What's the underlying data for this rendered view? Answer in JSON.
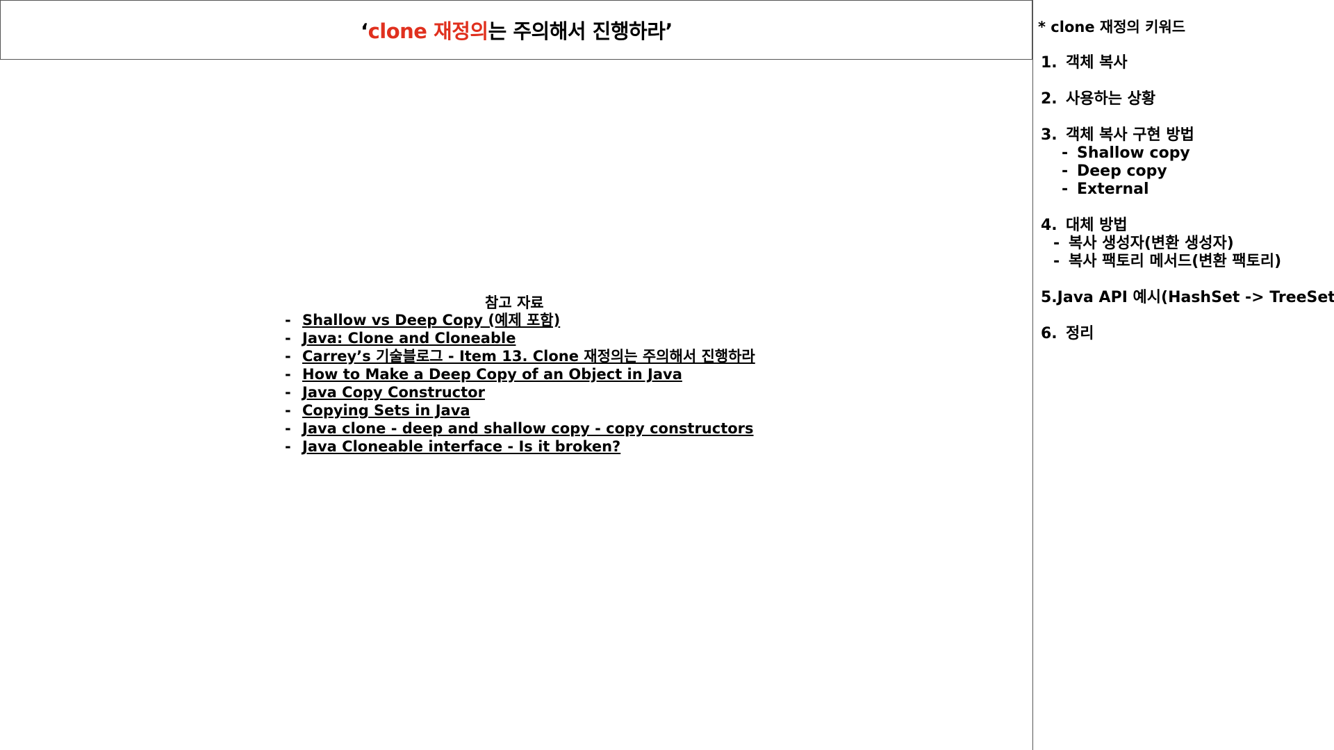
{
  "title": {
    "open_quote": "‘",
    "accent": "clone 재정의",
    "rest": "는 주의해서 진행하라",
    "close_quote": "’"
  },
  "colors": {
    "accent": "#e0301e",
    "text": "#000000",
    "border": "#555555"
  },
  "references": {
    "heading": "참고 자료",
    "dash": "-",
    "items": [
      "Shallow vs Deep Copy (예제 포함)",
      "Java: Clone and Cloneable",
      "Carrey’s 기술블로그 - Item 13. Clone 재정의는 주의해서 진행하라",
      "How to Make a Deep Copy of an Object in Java",
      "Java Copy Constructor",
      "Copying Sets in Java",
      "Java clone - deep and shallow copy  - copy constructors",
      "Java Cloneable interface - Is it broken?"
    ]
  },
  "keywords": {
    "heading": "* clone 재정의 키워드",
    "dash": "-",
    "items": [
      {
        "num": "1.",
        "label": "객체 복사",
        "subs": []
      },
      {
        "num": "2.",
        "label": "사용하는 상황",
        "subs": []
      },
      {
        "num": "3.",
        "label": "객체 복사 구현 방법",
        "subs": [
          "Shallow copy",
          "Deep copy",
          "External"
        ]
      },
      {
        "num": "4.",
        "label": "대체 방법",
        "subs": [
          "복사 생성자(변환 생성자)",
          "복사 팩토리 메서드(변환 팩토리)"
        ]
      },
      {
        "num": "5.",
        "label": "Java API 예시(HashSet -> TreeSet)",
        "subs": []
      },
      {
        "num": "6.",
        "label": "정리",
        "subs": []
      }
    ]
  }
}
